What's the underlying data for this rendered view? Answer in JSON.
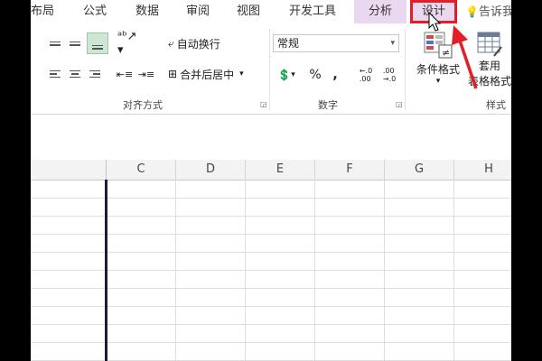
{
  "ribbon_tabs": [
    {
      "label": "布局"
    },
    {
      "label": "公式"
    },
    {
      "label": "数据"
    },
    {
      "label": "审阅"
    },
    {
      "label": "视图"
    },
    {
      "label": "开发工具"
    },
    {
      "label": "分析"
    },
    {
      "label": "设计"
    },
    {
      "label": "告诉我"
    }
  ],
  "alignment": {
    "wrap_text_label": "自动换行",
    "merge_center_label": "合并后居中",
    "group_label": "对齐方式"
  },
  "number": {
    "format_value": "常规",
    "percent_symbol": "%",
    "comma_symbol": ",",
    "increase_decimal_text": "←.0\n.00",
    "decrease_decimal_text": ".00\n→.0",
    "group_label": "数字"
  },
  "styles": {
    "conditional_format_label": "条件格式",
    "table_format_label_line1": "套用",
    "table_format_label_line2": "表格格式",
    "group_label": "样式"
  },
  "columns": [
    "C",
    "D",
    "E",
    "F",
    "G",
    "H"
  ],
  "colors": {
    "context_tab_bg": "#ead7f0",
    "highlight_border": "#e01f26",
    "selected_align_bg": "#cfe6d5"
  }
}
